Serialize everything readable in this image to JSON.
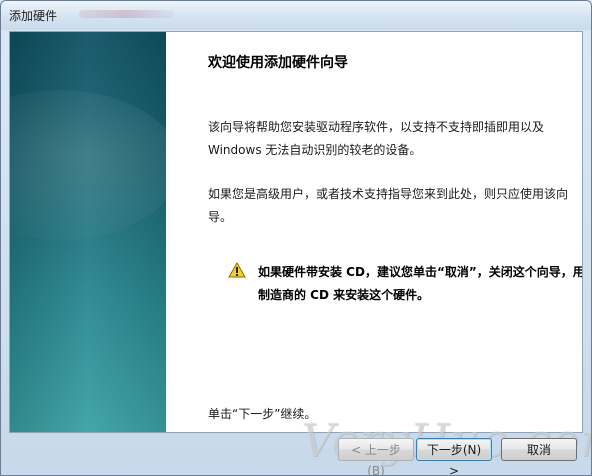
{
  "window": {
    "title": "添加硬件"
  },
  "wizard": {
    "heading": "欢迎使用添加硬件向导",
    "intro": "该向导将帮助您安装驱动程序软件，以支持不支持即插即用以及 Windows 无法自动识别的较老的设备。",
    "advice": "如果您是高级用户，或者技术支持指导您来到此处，则只应使用该向导。",
    "warning": "如果硬件带安装 CD，建议您单击“取消”，关闭这个向导，用制造商的 CD 来安装这个硬件。",
    "instruction": "单击“下一步”继续。"
  },
  "buttons": {
    "back": "< 上一步(B)",
    "next": "下一步(N) >",
    "cancel": "取消"
  },
  "watermark": "VeryHuo.com"
}
